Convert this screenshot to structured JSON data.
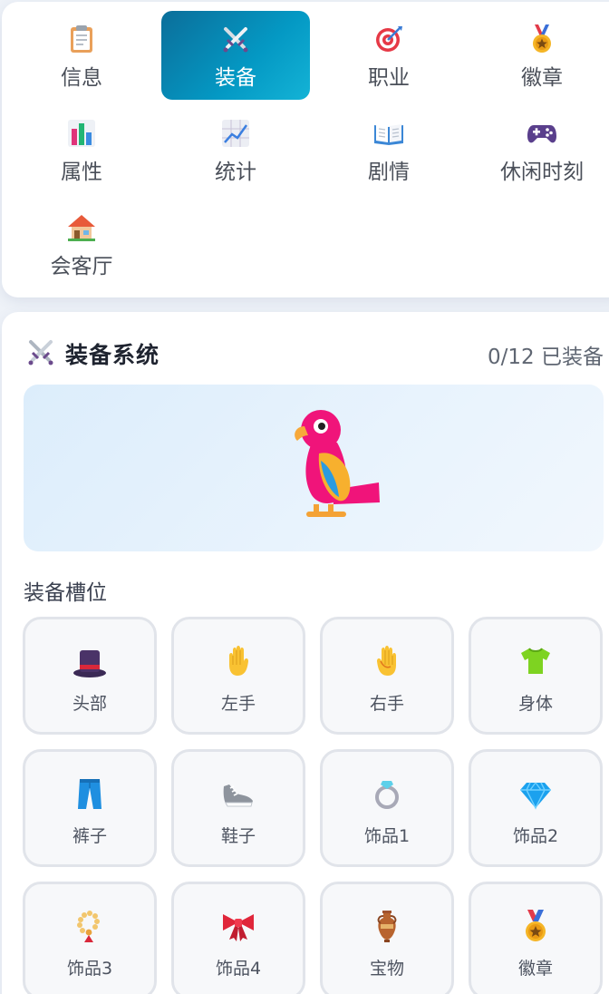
{
  "nav": {
    "items": [
      {
        "label": "信息",
        "icon": "clipboard-icon"
      },
      {
        "label": "装备",
        "icon": "crossed-swords-icon",
        "active": true
      },
      {
        "label": "职业",
        "icon": "target-icon"
      },
      {
        "label": "徽章",
        "icon": "medal-icon"
      },
      {
        "label": "属性",
        "icon": "bar-chart-icon"
      },
      {
        "label": "统计",
        "icon": "line-chart-icon"
      },
      {
        "label": "剧情",
        "icon": "open-book-icon"
      },
      {
        "label": "休闲时刻",
        "icon": "gamepad-icon"
      },
      {
        "label": "会客厅",
        "icon": "house-icon"
      }
    ],
    "active_color_start": "#0b6e9a",
    "active_color_end": "#14b3d6"
  },
  "equipment": {
    "title": "装备系统",
    "title_icon": "crossed-swords-icon",
    "count_text": "0/12 已装备",
    "avatar": "parrot-icon",
    "slots_heading": "装备槽位",
    "slots": [
      {
        "label": "头部",
        "icon": "top-hat-icon"
      },
      {
        "label": "左手",
        "icon": "raised-hand-icon"
      },
      {
        "label": "右手",
        "icon": "raised-hand-icon"
      },
      {
        "label": "身体",
        "icon": "t-shirt-icon"
      },
      {
        "label": "裤子",
        "icon": "jeans-icon"
      },
      {
        "label": "鞋子",
        "icon": "sneaker-icon"
      },
      {
        "label": "饰品1",
        "icon": "ring-icon"
      },
      {
        "label": "饰品2",
        "icon": "gem-icon"
      },
      {
        "label": "饰品3",
        "icon": "prayer-beads-icon"
      },
      {
        "label": "饰品4",
        "icon": "ribbon-icon"
      },
      {
        "label": "宝物",
        "icon": "amphora-icon"
      },
      {
        "label": "徽章",
        "icon": "medal-icon"
      }
    ]
  }
}
